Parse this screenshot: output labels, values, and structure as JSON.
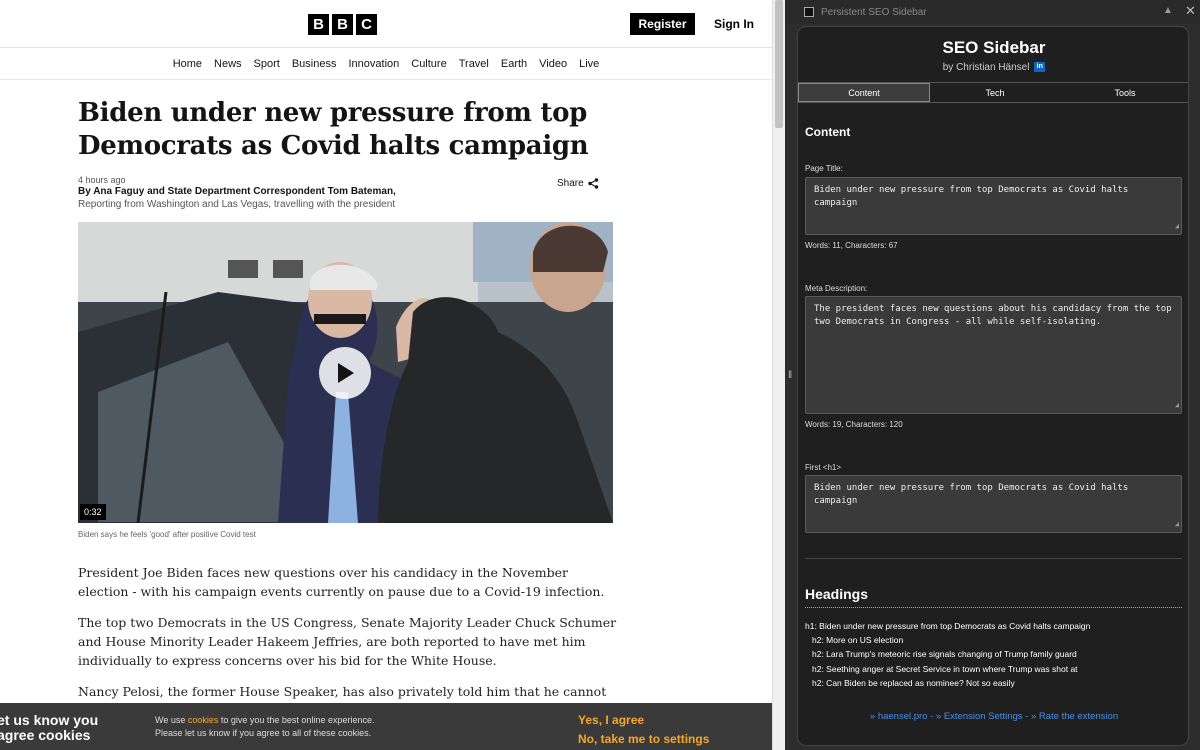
{
  "page": {
    "logo_letters": [
      "B",
      "B",
      "C"
    ],
    "register_label": "Register",
    "signin_label": "Sign In",
    "nav": [
      "Home",
      "News",
      "Sport",
      "Business",
      "Innovation",
      "Culture",
      "Travel",
      "Earth",
      "Video",
      "Live"
    ],
    "headline": "Biden under new pressure from top Democrats as Covid halts campaign",
    "timestamp": "4 hours ago",
    "byline": "By Ana Faguy and State Department Correspondent Tom Bateman,",
    "byline_sub": "Reporting from Washington and Las Vegas, travelling with the president",
    "share_label": "Share",
    "video_duration": "0:32",
    "caption": "Biden says he feels 'good' after positive Covid test",
    "paragraphs": [
      "President Joe Biden faces new questions over his candidacy in the November election - with his campaign events currently on pause due to a Covid-19 infection.",
      "The top two Democrats in the US Congress, Senate Majority Leader Chuck Schumer and House Minority Leader Hakeem Jeffries, are both reported to have met him individually to express concerns over his bid for the White House.",
      "Nancy Pelosi, the former House Speaker, has also privately told him that he cannot"
    ],
    "cookie": {
      "title": "et us know you agree cookies",
      "text_pre": "We use ",
      "text_link": "cookies",
      "text_post": " to give you the best online experience.",
      "text_line2": "Please let us know if you agree to all of these cookies.",
      "yes_label": "Yes, I agree",
      "no_label": "No, take me to settings"
    }
  },
  "sidebar": {
    "window_title": "Persistent SEO Sidebar",
    "title": "SEO Sidebar",
    "author": "by Christian Hänsel",
    "linkedin_label": "in",
    "tabs": [
      "Content",
      "Tech",
      "Tools"
    ],
    "active_tab": "Content",
    "content_heading": "Content",
    "page_title_label": "Page Title:",
    "page_title_value": "Biden under new pressure from top Democrats as Covid halts campaign",
    "page_title_count": "Words: 11, Characters: 67",
    "meta_label": "Meta Description:",
    "meta_value": "The president faces new questions about his candidacy from the top two Democrats in Congress - all while self-isolating.",
    "meta_count": "Words: 19, Characters: 120",
    "h1_label": "First <h1>",
    "h1_value": "Biden under new pressure from top Democrats as Covid halts campaign",
    "headings_heading": "Headings",
    "headings": [
      "h1: Biden under new pressure from top Democrats as Covid halts campaign",
      "h2: More on US election",
      "h2: Lara Trump's meteoric rise signals changing of Trump family guard",
      "h2: Seething anger at Secret Service in town where Trump was shot at",
      "h2: Can Biden be replaced as nominee? Not so easily"
    ],
    "footer": "» haensel.pro - » Extension Settings - » Rate the extension"
  },
  "colors": {
    "accent": "#f7a826",
    "link": "#4b8ee8",
    "panel_bg": "#1f1f1f"
  }
}
